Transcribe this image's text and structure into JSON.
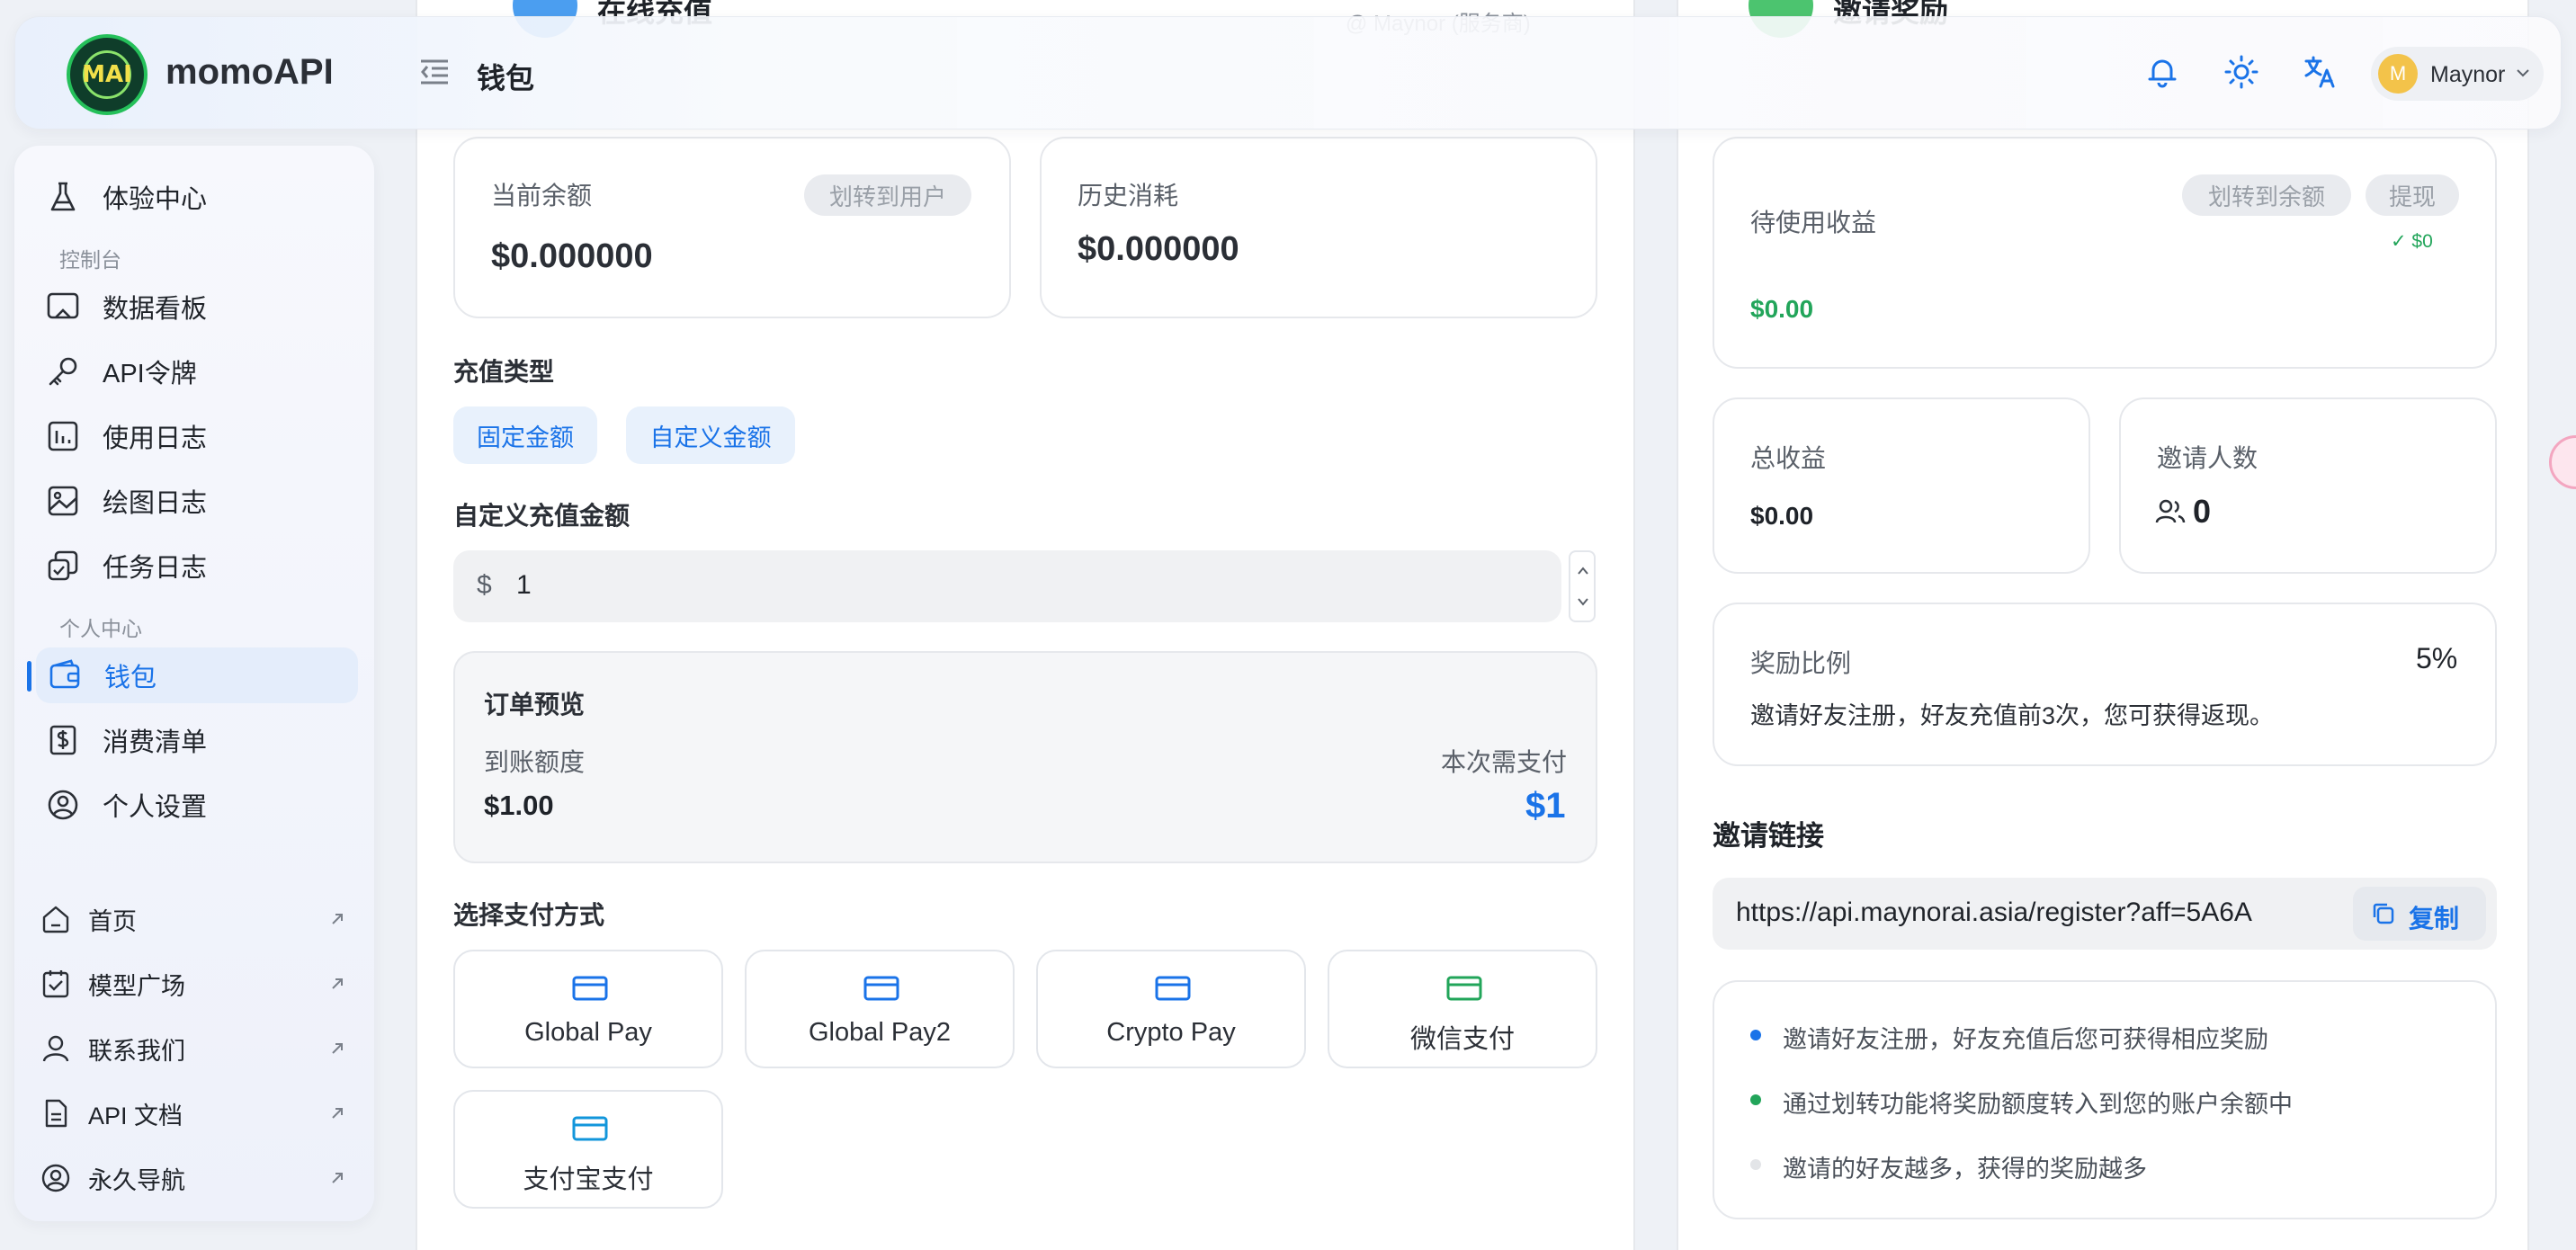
{
  "header": {
    "brand": "momoAPI",
    "logo_text": "MAI",
    "title": "钱包",
    "user_initial": "M",
    "user_name": "Maynor"
  },
  "top_partial": {
    "recharge_title": "在线充值",
    "recharge_right": "@ Maynor (服务商)",
    "invite_title": "邀请奖励"
  },
  "sidebar": {
    "items": [
      {
        "label": "体验中心",
        "icon": "flask-icon"
      },
      {
        "label": "数据看板",
        "icon": "dashboard-icon"
      },
      {
        "label": "API令牌",
        "icon": "key-icon"
      },
      {
        "label": "使用日志",
        "icon": "chart-icon"
      },
      {
        "label": "绘图日志",
        "icon": "image-icon"
      },
      {
        "label": "任务日志",
        "icon": "tasks-icon"
      },
      {
        "label": "钱包",
        "icon": "wallet-icon"
      },
      {
        "label": "消费清单",
        "icon": "bill-icon"
      },
      {
        "label": "个人设置",
        "icon": "user-circle-icon"
      }
    ],
    "section_console": "控制台",
    "section_personal": "个人中心",
    "links": [
      {
        "label": "首页",
        "icon": "home-icon"
      },
      {
        "label": "模型广场",
        "icon": "checklist-icon"
      },
      {
        "label": "联系我们",
        "icon": "person-icon"
      },
      {
        "label": "API 文档",
        "icon": "document-icon"
      },
      {
        "label": "永久导航",
        "icon": "user-badge-icon"
      }
    ]
  },
  "wallet": {
    "balance_label": "当前余额",
    "balance_value": "$0.000000",
    "transfer_user_label": "划转到用户",
    "history_label": "历史消耗",
    "history_value": "$0.000000",
    "recharge_type_label": "充值类型",
    "tab_fixed": "固定金额",
    "tab_custom": "自定义金额",
    "custom_amount_label": "自定义充值金额",
    "currency_prefix": "$",
    "amount_value": "1",
    "order_preview_title": "订单预览",
    "credit_label": "到账额度",
    "credit_value": "$1.00",
    "pay_label": "本次需支付",
    "pay_value": "$1",
    "payment_method_label": "选择支付方式",
    "payment_methods": [
      {
        "label": "Global Pay",
        "color": "#1a73e8"
      },
      {
        "label": "Global Pay2",
        "color": "#1a73e8"
      },
      {
        "label": "Crypto Pay",
        "color": "#1a73e8"
      },
      {
        "label": "微信支付",
        "color": "#22a55a"
      },
      {
        "label": "支付宝支付",
        "color": "#1296db"
      }
    ]
  },
  "invite": {
    "pending_label": "待使用收益",
    "transfer_balance_label": "划转到余额",
    "withdraw_label": "提现",
    "withdraw_note": "✓ $0",
    "pending_value": "$0.00",
    "total_label": "总收益",
    "total_value": "$0.00",
    "count_label": "邀请人数",
    "count_value": "0",
    "ratio_label": "奖励比例",
    "ratio_value": "5%",
    "ratio_desc": "邀请好友注册，好友充值前3次，您可获得返现。",
    "link_title": "邀请链接",
    "link_value": "https://api.maynorai.asia/register?aff=5A6A",
    "copy_label": "复制",
    "tips": [
      {
        "text": "邀请好友注册，好友充值后您可获得相应奖励",
        "color": "#1a73e8"
      },
      {
        "text": "通过划转功能将奖励额度转入到您的账户余额中",
        "color": "#22a55a"
      },
      {
        "text": "邀请的好友越多，获得的奖励越多",
        "color": "#e3e5e8"
      }
    ]
  },
  "colors": {
    "accent": "#1a73e8",
    "success": "#22a55a"
  }
}
